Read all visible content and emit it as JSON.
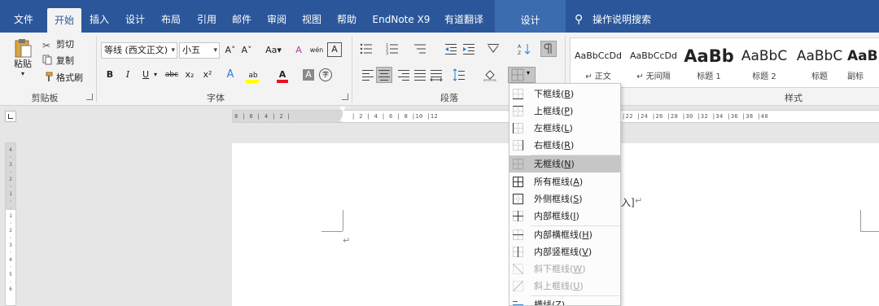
{
  "tabs": [
    {
      "label": "文件"
    },
    {
      "label": "开始"
    },
    {
      "label": "插入"
    },
    {
      "label": "设计"
    },
    {
      "label": "布局"
    },
    {
      "label": "引用"
    },
    {
      "label": "邮件"
    },
    {
      "label": "审阅"
    },
    {
      "label": "视图"
    },
    {
      "label": "帮助"
    },
    {
      "label": "EndNote X9"
    },
    {
      "label": "有道翻译"
    }
  ],
  "context_tab": "设计",
  "tell_me": "操作说明搜索",
  "clipboard": {
    "paste": "粘贴",
    "cut": "剪切",
    "copy": "复制",
    "format_painter": "格式刷",
    "group": "剪贴板"
  },
  "font": {
    "name": "等线 (西文正文)",
    "size": "小五",
    "grow": "A˄",
    "shrink": "A˅",
    "case": "Aa",
    "clear": "A",
    "phonetic": "wén",
    "border_char": "A",
    "bold": "B",
    "italic": "I",
    "underline": "U",
    "strike": "abc",
    "sub": "x₂",
    "sup": "x²",
    "effect": "A",
    "highlight": "ab",
    "color": "A",
    "shading": "A",
    "enclose": "字",
    "group": "字体"
  },
  "paragraph": {
    "group": "段落"
  },
  "styles": {
    "group": "样式",
    "items": [
      {
        "sample": "AaBbCcDd",
        "name": "↵ 正文"
      },
      {
        "sample": "AaBbCcDd",
        "name": "↵ 无间隔"
      },
      {
        "sample": "AaBb",
        "name": "标题 1"
      },
      {
        "sample": "AaBbC",
        "name": "标题 2"
      },
      {
        "sample": "AaBbC",
        "name": "标题"
      },
      {
        "sample": "AaB",
        "name": "副标"
      }
    ]
  },
  "ruler": {
    "h_left": "8 | 6 | 4 | 2 |",
    "h_right": "| 2 | 4 | 6 | 8 |10 |12",
    "h_far": "|22 |24 |26 |28 |30 |32 |34 |36 |38 |40",
    "v_nums": "4 · 3 · 2 · 1 · · 1 · 2 · 3 · 4 · 5 · 6"
  },
  "document": {
    "fragment": "入]",
    "return_mark": "↵"
  },
  "border_menu": {
    "items": [
      {
        "label": "下框线(",
        "key": "B",
        "tail": ")",
        "icon": "bottom-border-icon",
        "state": "normal"
      },
      {
        "label": "上框线(",
        "key": "P",
        "tail": ")",
        "icon": "top-border-icon",
        "state": "normal"
      },
      {
        "label": "左框线(",
        "key": "L",
        "tail": ")",
        "icon": "left-border-icon",
        "state": "normal"
      },
      {
        "label": "右框线(",
        "key": "R",
        "tail": ")",
        "icon": "right-border-icon",
        "state": "normal"
      },
      {
        "label": "无框线(",
        "key": "N",
        "tail": ")",
        "icon": "no-border-icon",
        "state": "highlighted"
      },
      {
        "label": "所有框线(",
        "key": "A",
        "tail": ")",
        "icon": "all-borders-icon",
        "state": "normal"
      },
      {
        "label": "外侧框线(",
        "key": "S",
        "tail": ")",
        "icon": "outside-borders-icon",
        "state": "normal"
      },
      {
        "label": "内部框线(",
        "key": "I",
        "tail": ")",
        "icon": "inside-borders-icon",
        "state": "normal"
      },
      {
        "label": "内部横框线(",
        "key": "H",
        "tail": ")",
        "icon": "inside-horizontal-border-icon",
        "state": "normal"
      },
      {
        "label": "内部竖框线(",
        "key": "V",
        "tail": ")",
        "icon": "inside-vertical-border-icon",
        "state": "normal"
      },
      {
        "label": "斜下框线(",
        "key": "W",
        "tail": ")",
        "icon": "diagonal-down-border-icon",
        "state": "disabled"
      },
      {
        "label": "斜上框线(",
        "key": "U",
        "tail": ")",
        "icon": "diagonal-up-border-icon",
        "state": "disabled"
      },
      {
        "label": "横线(",
        "key": "Z",
        "tail": ")",
        "icon": "horizontal-line-icon",
        "state": "normal"
      }
    ]
  },
  "colors": {
    "brand": "#2b579a",
    "context": "#3c6cb0",
    "highlight": "#c6c6c6",
    "font_red": "#e81123",
    "highlight_yellow": "#ffff00"
  }
}
